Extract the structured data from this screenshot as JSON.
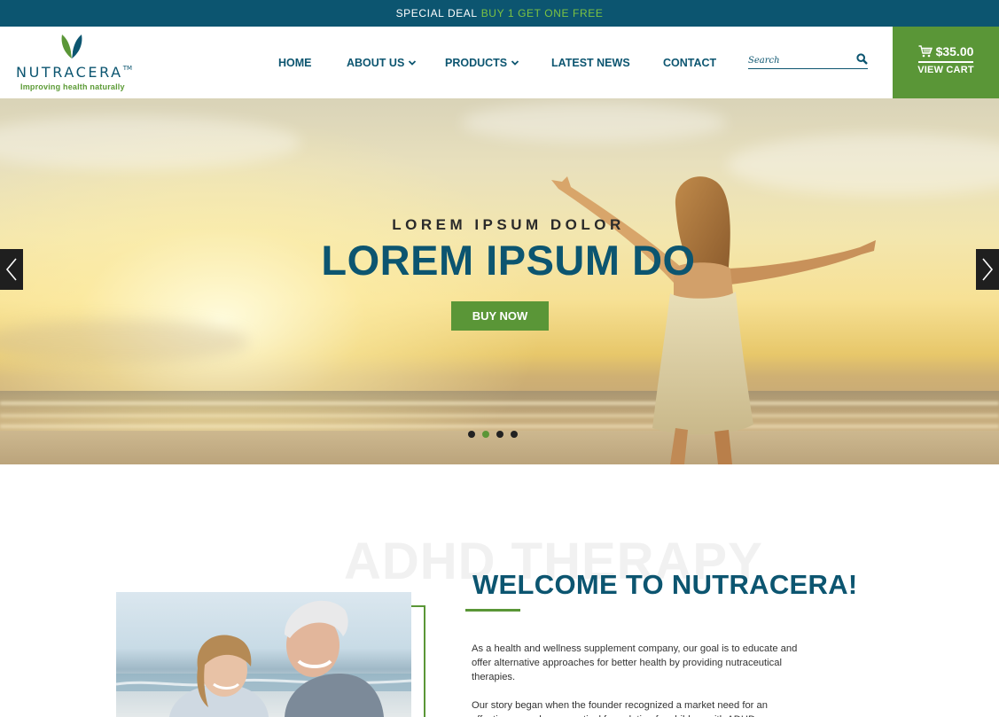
{
  "promo": {
    "text": "SPECIAL DEAL",
    "highlight": "BUY 1 GET ONE FREE"
  },
  "logo": {
    "name": "NUTRACERA",
    "trademark": "TM",
    "tagline": "Improving health naturally"
  },
  "nav": {
    "items": [
      {
        "label": "HOME",
        "has_dropdown": false
      },
      {
        "label": "ABOUT US",
        "has_dropdown": true
      },
      {
        "label": "PRODUCTS",
        "has_dropdown": true
      },
      {
        "label": "LATEST NEWS",
        "has_dropdown": false
      },
      {
        "label": "CONTACT",
        "has_dropdown": false
      }
    ]
  },
  "search": {
    "placeholder": "Search",
    "value": "",
    "icon": "search-icon"
  },
  "cart": {
    "amount": "$35.00",
    "label": "VIEW CART",
    "icon": "cart-icon"
  },
  "hero": {
    "subtitle": "LOREM IPSUM DOLOR",
    "title": "LOREM IPSUM DO",
    "button_label": "BUY NOW",
    "slide_count": 4,
    "active_slide": 2
  },
  "welcome": {
    "watermark": "ADHD THERAPY",
    "title": "WELCOME TO NUTRACERA!",
    "paragraph1": "As a health and wellness supplement company, our goal is to educate and offer alternative approaches for better health by providing nutraceutical therapies.",
    "paragraph2": "Our story began when the founder recognized a market need for an effective, non-pharmaceutical formulation for children with ADHD"
  },
  "colors": {
    "brand_blue": "#0c5570",
    "brand_green": "#5a9637",
    "accent_green": "#7cc242"
  }
}
